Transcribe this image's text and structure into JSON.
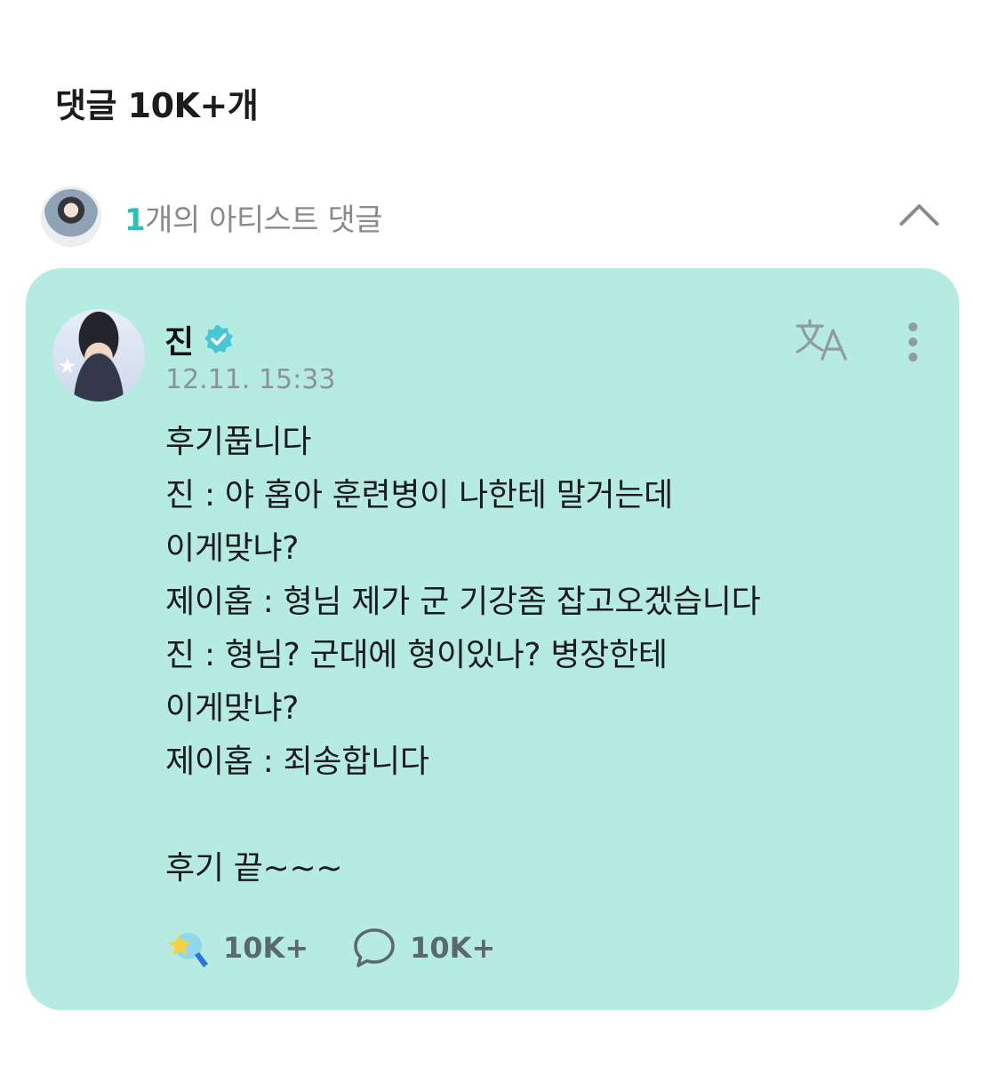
{
  "header": {
    "title": "댓글 10K+개"
  },
  "artist_comments": {
    "count": "1",
    "label": "개의 아티스트 댓글"
  },
  "comment": {
    "author": "진",
    "timestamp": "12.11. 15:33",
    "body_lines": [
      "후기풉니다",
      "진 : 야 홉아 훈련병이 나한테 말거는데",
      "이게맞냐?",
      "제이홉 : 형님 제가 군 기강좀 잡고오겠습니다",
      "진 : 형님? 군대에 형이있나? 병장한테",
      "이게맞냐?",
      "제이홉 : 죄송합니다",
      "",
      "후기 끝~~~"
    ],
    "like_count": "10K+",
    "reply_count": "10K+"
  },
  "icons": {
    "collapse": "chevron-up-icon",
    "verified": "verified-badge-icon",
    "translate": "translate-icon",
    "more": "more-vertical-icon",
    "like": "star-wand-icon",
    "reply": "speech-bubble-icon"
  },
  "colors": {
    "card_background": "#b5ebe1",
    "accent": "#2cc1b5",
    "verified_badge": "#47c7d6"
  }
}
